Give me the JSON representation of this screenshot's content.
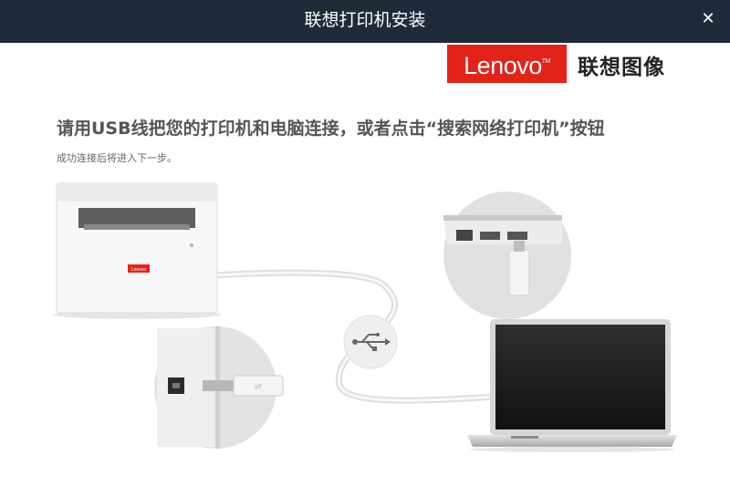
{
  "window": {
    "title": "联想打印机安装",
    "close_glyph": "✕"
  },
  "brand": {
    "logo_text": "Lenovo",
    "logo_mark": "TM",
    "name": "联想图像",
    "color": "#e2231a"
  },
  "instructions": {
    "heading": "请用USB线把您的打印机和电脑连接，或者点击“搜索网络打印机”按钮",
    "subtext": "成功连接后将进入下一步。"
  },
  "illustration": {
    "printer_label": "Lenovo",
    "icons": [
      "printer-icon",
      "usb-port-closeup",
      "usb-symbol-icon",
      "laptop-port-closeup",
      "laptop-icon"
    ]
  },
  "colors": {
    "titlebar": "#1f2b38",
    "accent": "#e2231a"
  }
}
